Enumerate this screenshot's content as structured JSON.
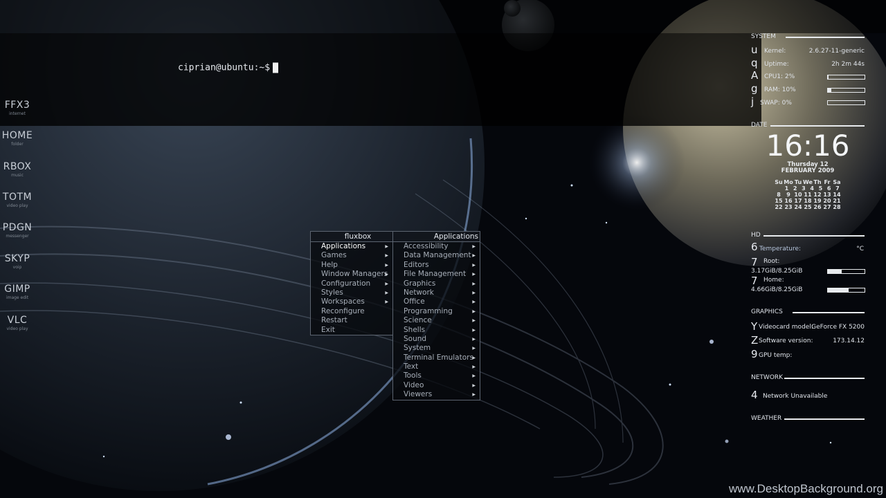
{
  "terminal": {
    "prompt": "ciprian@ubuntu:~$"
  },
  "launchers": [
    {
      "label": "FFX3",
      "sub": "internet"
    },
    {
      "label": "HOME",
      "sub": "folder"
    },
    {
      "label": "RBOX",
      "sub": "music"
    },
    {
      "label": "TOTM",
      "sub": "video play"
    },
    {
      "label": "PDGN",
      "sub": "messenger"
    },
    {
      "label": "SKYP",
      "sub": "voip"
    },
    {
      "label": "GIMP",
      "sub": "image edit"
    },
    {
      "label": "VLC",
      "sub": "video play"
    }
  ],
  "fluxbox_menu": {
    "title": "fluxbox",
    "items": [
      "Applications",
      "Games",
      "Help",
      "Window Managers",
      "Configuration",
      "Styles",
      "Workspaces",
      "Reconfigure",
      "Restart",
      "Exit"
    ],
    "selected": "Applications"
  },
  "applications_menu": {
    "title": "Applications",
    "items": [
      "Accessibility",
      "Data Management",
      "Editors",
      "File Management",
      "Graphics",
      "Network",
      "Office",
      "Programming",
      "Science",
      "Shells",
      "Sound",
      "System",
      "Terminal Emulators",
      "Text",
      "Tools",
      "Video",
      "Viewers"
    ]
  },
  "conky": {
    "system": {
      "header": "SYSTEM",
      "kernel_glyph": "u",
      "kernel_label": "Kernel:",
      "kernel_value": "2.6.27-11-generic",
      "uptime_glyph": "q",
      "uptime_label": "Uptime:",
      "uptime_value": "2h 2m 44s",
      "cpu_glyph": "A",
      "cpu_label": "CPU1: 2%",
      "cpu_fraction": 0.02,
      "ram_glyph": "g",
      "ram_label": "RAM: 10%",
      "ram_fraction": 0.1,
      "swap_glyph": "j",
      "swap_label": "SWAP: 0%",
      "swap_fraction": 0.0
    },
    "date": {
      "header": "DATE",
      "time": "16:16",
      "day_line": "Thursday 12",
      "month_line": "FEBRUARY 2009",
      "calendar": [
        [
          "Su",
          "Mo",
          "Tu",
          "We",
          "Th",
          "Fr",
          "Sa"
        ],
        [
          "",
          "1",
          "2",
          "3",
          "4",
          "5",
          "6",
          "7"
        ],
        [
          "8",
          "9",
          "10",
          "11",
          "12",
          "13",
          "14"
        ],
        [
          "15",
          "16",
          "17",
          "18",
          "19",
          "20",
          "21"
        ],
        [
          "22",
          "23",
          "24",
          "25",
          "26",
          "27",
          "28"
        ]
      ]
    },
    "hd": {
      "header": "HD",
      "temp_glyph": "6",
      "temp_label": "Temperature:",
      "temp_unit": "°C",
      "root_glyph": "7",
      "root_label": "Root:",
      "root_value": "3.17GiB/8.25GiB",
      "root_fraction": 0.38,
      "home_glyph": "7",
      "home_label": "Home:",
      "home_value": "4.66GiB/8.25GiB",
      "home_fraction": 0.56
    },
    "graphics": {
      "header": "GRAPHICS",
      "card_glyph": "Y",
      "card_label": "Videocard model:",
      "card_value": "GeForce FX 5200",
      "sw_glyph": "Z",
      "sw_label": "Software version:",
      "sw_value": "173.14.12",
      "gpu_glyph": "9",
      "gpu_label": "GPU temp:"
    },
    "network": {
      "header": "NETWORK",
      "glyph": "4",
      "status": "Network Unavailable"
    },
    "weather": {
      "header": "WEATHER"
    }
  },
  "watermark": "www.DesktopBackground.org",
  "colors": {
    "menu_border": "#5c6470",
    "conky_text": "#dfe3e9",
    "background": "#05070c"
  }
}
